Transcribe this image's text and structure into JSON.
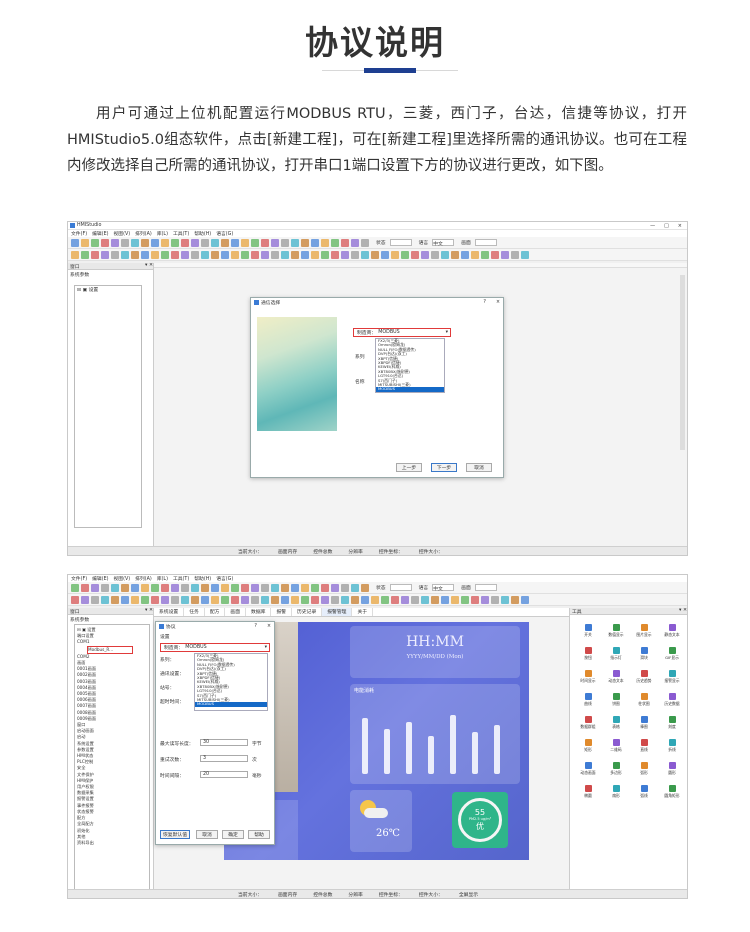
{
  "article": {
    "title": "协议说明",
    "intro": "用户可通过上位机配置运行MODBUS RTU，三菱，西门子，台达，信捷等协议，打开HMIStudio5.0组态软件，点击[新建工程]，可在[新建工程]里选择所需的通讯协议。也可在工程内修改选择自己所需的通讯协议，打开串口1端口设置下方的协议进行更改，如下图。"
  },
  "colors": {
    "accent": "#1e3f91",
    "highlight_box": "#e03a3a",
    "selected_row": "#1469c7"
  },
  "screenshot1": {
    "app_title": "HMIStudio",
    "menu": [
      "文件(F)",
      "编辑(E)",
      "视图(V)",
      "排列(A)",
      "库(L)",
      "工具(T)",
      "帮助(H)",
      "语言(G)"
    ],
    "toolbar_labels": {
      "status": "状态",
      "language": "语言",
      "lang_value": "中文",
      "screen": "画面"
    },
    "left_pane_title": "窗口",
    "tree_title": "系统参数",
    "tree_items": [
      "设置"
    ],
    "dialog": {
      "title": "通信选择",
      "controls": [
        "?",
        "×"
      ],
      "protocol_label": "制造商",
      "protocol_value": "MODBUS",
      "series_label": "系列",
      "name_label": "名称",
      "list_items": [
        "FX2/3(三菱)",
        "Omron(欧姆龙)",
        "NULL FIFO(数据透传)",
        "DVP(台达)(双工)",
        "XBPT(信捷)",
        "XBPDF(信捷)",
        "KEWEI(科威)",
        "XBT80BX(施耐德)",
        "LGT910(台达)",
        "S7(西门子)",
        "MITSUBISHI(三菱)",
        "MODBUS"
      ],
      "selected_index": 11,
      "buttons": {
        "back": "上一步",
        "next": "下一步",
        "cancel": "取消"
      }
    },
    "status": [
      "当前大小：",
      "画面内存",
      "控件总数",
      "分辨率",
      "控件坐标：",
      "控件大小："
    ]
  },
  "screenshot2": {
    "menu": [
      "文件(F)",
      "编辑(E)",
      "视图(V)",
      "排列(A)",
      "库(L)",
      "工具(T)",
      "帮助(H)",
      "语言(G)"
    ],
    "tabs": [
      "系统设置",
      "任务",
      "配方",
      "画面",
      "数据库",
      "报警",
      "历史记录",
      "报警管理",
      "关于"
    ],
    "left_pane_title": "窗口",
    "tree_title": "系统参数",
    "tree_items": [
      "设置",
      "端口设置",
      "COM1",
      "Modbus_R...",
      "COM2",
      "画面",
      "0001画面",
      "0002画面",
      "0003画面",
      "0004画面",
      "0005画面",
      "0006画面",
      "0007画面",
      "0008画面",
      "0009画面",
      "窗口",
      "启动画面",
      "启动",
      "系统设置",
      "参数设置",
      "HMI状态",
      "PLC控制",
      "安全",
      "文件保护",
      "HMI保护",
      "用户权限",
      "数据采集",
      "报警设置",
      "事件报警",
      "状态报警",
      "配方",
      "全局配方",
      "初始化",
      "其他",
      "资料导出"
    ],
    "dialog": {
      "title": "协议",
      "controls": [
        "?",
        "×"
      ],
      "section": "设置",
      "protocol_label": "制造商",
      "protocol_value": "MODBUS",
      "fields": [
        {
          "label": "系列",
          "value": ""
        },
        {
          "label": "通讯设置",
          "value": ""
        },
        {
          "label": "站号",
          "value": ""
        },
        {
          "label": "超时时间",
          "value": ""
        },
        {
          "label": "最大读写长度",
          "value": "30",
          "unit": "字节"
        },
        {
          "label": "重试次数",
          "value": "3",
          "unit": "次"
        },
        {
          "label": "时间间隔",
          "value": "20",
          "unit": "毫秒"
        }
      ],
      "buttons": {
        "restore": "恢复默认值",
        "cancel": "取消",
        "ok": "确定",
        "help": "帮助"
      }
    },
    "hmi": {
      "clock": "HH:MM",
      "date": "YYYY/MM/DD  (Mon)",
      "temperature": "26℃",
      "gauge_value": "55",
      "gauge_unit": "PM2.5 ug/m³",
      "gauge_label": "优",
      "chart_title": "电能消耗"
    },
    "toolbox": {
      "title": "工具",
      "items": [
        "开关",
        "数值显示",
        "图片显示",
        "静态文本",
        "按钮",
        "指示灯",
        "滑块",
        "GIF显示",
        "时间显示",
        "动态文本",
        "历史趋势",
        "报警显示",
        "曲线",
        "饼图",
        "柱状图",
        "历史数据",
        "数据群组",
        "表格",
        "棒图",
        "刻度",
        "矩形",
        "二维码",
        "直线",
        "折线",
        "动态画面",
        "多边形",
        "弧形",
        "圆形",
        "椭圆",
        "扇形",
        "弧线",
        "圆角矩形"
      ]
    },
    "status": [
      "当前大小：",
      "画面内存",
      "控件总数",
      "分辨率",
      "控件坐标：",
      "控件大小：",
      "全屏显示"
    ]
  }
}
